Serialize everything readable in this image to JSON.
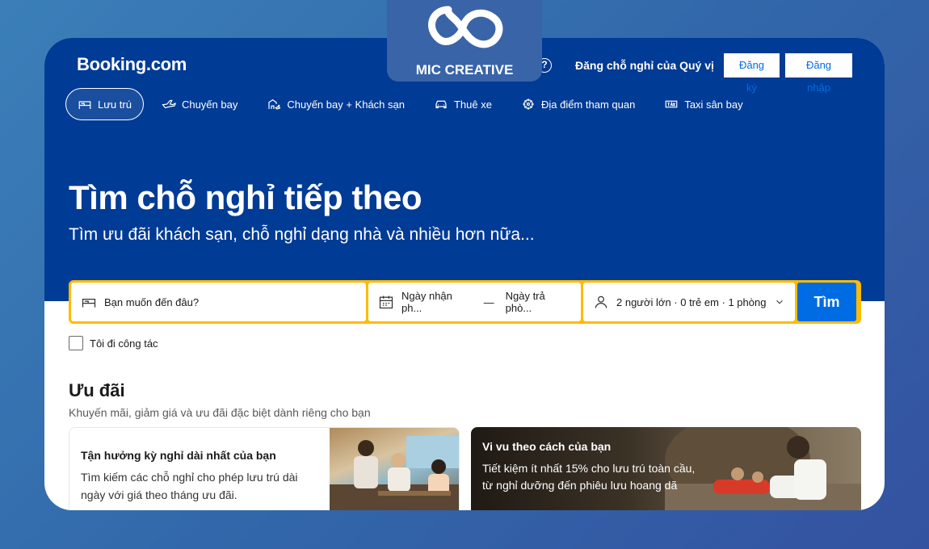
{
  "header": {
    "logo": "Booking.com",
    "help_icon": "?",
    "list_property": "Đăng chỗ nghỉ của Quý vị",
    "register": "Đăng ký",
    "signin": "Đăng nhập"
  },
  "nav": [
    {
      "label": "Lưu trú",
      "icon": "bed-icon",
      "active": true
    },
    {
      "label": "Chuyến bay",
      "icon": "plane-icon"
    },
    {
      "label": "Chuyến bay + Khách sạn",
      "icon": "flight-hotel-icon"
    },
    {
      "label": "Thuê xe",
      "icon": "car-icon"
    },
    {
      "label": "Địa điểm tham quan",
      "icon": "attractions-icon"
    },
    {
      "label": "Taxi sân bay",
      "icon": "taxi-icon"
    }
  ],
  "hero": {
    "title": "Tìm chỗ nghỉ tiếp theo",
    "subtitle": "Tìm ưu đãi khách sạn, chỗ nghỉ dạng nhà và nhiều hơn nữa..."
  },
  "search": {
    "destination_placeholder": "Bạn muốn đến đâu?",
    "checkin": "Ngày nhận ph...",
    "separator": "—",
    "checkout": "Ngày trả phò...",
    "occupancy": "2 người lớn · 0 trẻ em · 1 phòng",
    "button": "Tìm",
    "accent": "#febb02"
  },
  "business_trip": "Tôi đi công tác",
  "deals": {
    "title": "Ưu đãi",
    "subtitle": "Khuyến mãi, giảm giá và ưu đãi đặc biệt dành riêng cho bạn",
    "cards": [
      {
        "title": "Tận hưởng kỳ nghỉ dài nhất của bạn",
        "description": "Tìm kiếm các chỗ nghỉ cho phép lưu trú dài ngày với giá theo tháng ưu đãi."
      },
      {
        "title": "Vi vu theo cách của bạn",
        "description": "Tiết kiệm ít nhất 15% cho lưu trú toàn cầu, từ nghỉ dưỡng đến phiêu lưu hoang dã"
      }
    ]
  },
  "watermark": {
    "text": "MIC CREATIVE"
  },
  "colors": {
    "brand": "#003b95",
    "primary": "#006ce4"
  }
}
